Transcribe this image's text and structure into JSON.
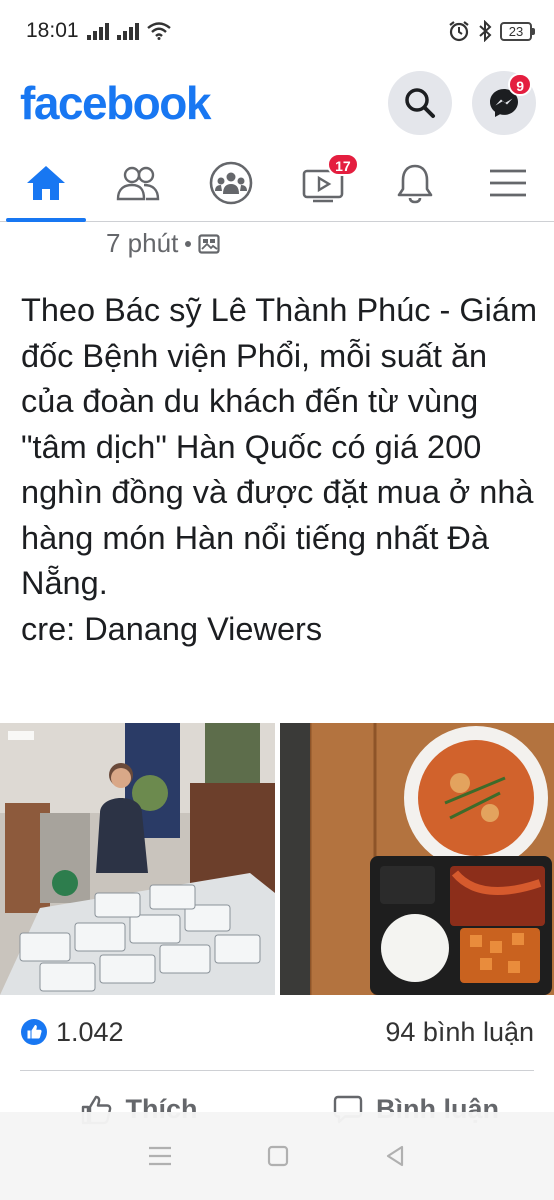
{
  "status_bar": {
    "time": "18:01",
    "battery": "23"
  },
  "header": {
    "logo": "facebook",
    "messenger_badge": "9",
    "brand_color": "#1877f2"
  },
  "nav": {
    "tabs": [
      {
        "icon": "home-icon",
        "active": true
      },
      {
        "icon": "friends-icon"
      },
      {
        "icon": "groups-icon"
      },
      {
        "icon": "watch-icon",
        "badge": "17"
      },
      {
        "icon": "bell-icon"
      },
      {
        "icon": "menu-icon"
      }
    ]
  },
  "post": {
    "time": "7 phút",
    "audience_icon": "public-icon",
    "text": "Theo Bác sỹ Lê Thành Phúc - Giám đốc Bệnh viện Phổi, mỗi suất ăn của đoàn du khách đến từ vùng \"tâm dịch\" Hàn Quốc có giá 200 nghìn đồng và được đặt mua ở nhà hàng món Hàn nổi tiếng nhất Đà Nẵng.",
    "credit": "cre: Danang Viewers",
    "reactions": "1.042",
    "comments": "94 bình luận",
    "like_label": "Thích",
    "comment_label": "Bình luận"
  }
}
